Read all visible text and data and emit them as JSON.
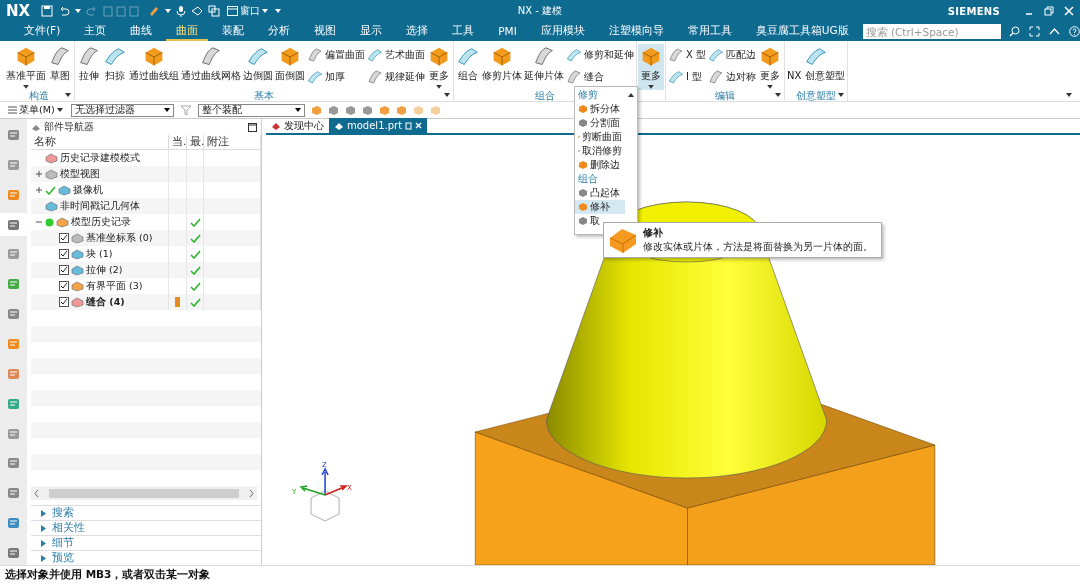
{
  "window": {
    "logo": "NX",
    "title": "NX - 建模",
    "brand": "SIEMENS",
    "window_menu": "窗口"
  },
  "menu_tabs": [
    {
      "label": "文件(F)",
      "selected": false
    },
    {
      "label": "主页",
      "selected": false
    },
    {
      "label": "曲线",
      "selected": false
    },
    {
      "label": "曲面",
      "selected": true
    },
    {
      "label": "装配",
      "selected": false
    },
    {
      "label": "分析",
      "selected": false
    },
    {
      "label": "视图",
      "selected": false
    },
    {
      "label": "显示",
      "selected": false
    },
    {
      "label": "选择",
      "selected": false
    },
    {
      "label": "工具",
      "selected": false
    },
    {
      "label": "PMI",
      "selected": false
    },
    {
      "label": "应用模块",
      "selected": false
    },
    {
      "label": "注塑模向导",
      "selected": false
    },
    {
      "label": "常用工具",
      "selected": false
    },
    {
      "label": "臭豆腐工具箱UG版",
      "selected": false
    }
  ],
  "search": {
    "placeholder": "搜索 (Ctrl+Space)"
  },
  "ribbon_groups": [
    {
      "label": "构造",
      "menu": true,
      "columns": [
        {
          "kind": "large",
          "label": "基准平面",
          "dropdown": true,
          "pressed": false
        },
        {
          "kind": "large",
          "label": "草图",
          "dropdown": false,
          "pressed": false
        }
      ]
    },
    {
      "label": "基本",
      "menu": true,
      "columns": [
        {
          "kind": "large",
          "label": "拉伸",
          "dropdown": false,
          "pressed": false
        },
        {
          "kind": "large",
          "label": "扫掠",
          "dropdown": false,
          "pressed": false
        },
        {
          "kind": "large",
          "label": "通过曲线组",
          "dropdown": false,
          "pressed": false
        },
        {
          "kind": "large",
          "label": "通过曲线网格",
          "dropdown": false,
          "pressed": false
        },
        {
          "kind": "large",
          "label": "边倒圆",
          "dropdown": false,
          "pressed": false
        },
        {
          "kind": "large",
          "label": "面倒圆",
          "dropdown": false,
          "pressed": false
        },
        {
          "kind": "stack",
          "items": [
            "偏置曲面",
            "加厚"
          ]
        },
        {
          "kind": "stack",
          "items": [
            "艺术曲面",
            "规律延伸"
          ]
        },
        {
          "kind": "large",
          "label": "更多",
          "dropdown": true,
          "pressed": false
        }
      ]
    },
    {
      "label": "组合",
      "columns": [
        {
          "kind": "large",
          "label": "组合",
          "dropdown": false,
          "pressed": false
        },
        {
          "kind": "large",
          "label": "修剪片体",
          "dropdown": false,
          "pressed": false
        },
        {
          "kind": "large",
          "label": "延伸片体",
          "dropdown": false,
          "pressed": false
        },
        {
          "kind": "stack",
          "items": [
            "修剪和延伸",
            "缝合"
          ]
        }
      ]
    },
    {
      "columns": [
        {
          "kind": "large",
          "label": "更多",
          "dropdown": true,
          "pressed": true
        }
      ]
    },
    {
      "label": "编辑",
      "menu": true,
      "columns": [
        {
          "kind": "stack",
          "items": [
            "X 型",
            "I 型"
          ]
        },
        {
          "kind": "stack",
          "items": [
            "匹配边",
            "边对称"
          ]
        },
        {
          "kind": "large",
          "label": "更多",
          "dropdown": true,
          "pressed": false
        }
      ]
    },
    {
      "label": "创意塑型",
      "menu": true,
      "columns": [
        {
          "kind": "large",
          "label": "NX 创意塑型",
          "dropdown": false,
          "pressed": false
        }
      ]
    }
  ],
  "toolbar": {
    "menu_button": "菜单(M)",
    "selection_filter": "无选择过滤器",
    "scope": "整个装配"
  },
  "resource_bar": [
    {
      "selected": false
    },
    {
      "selected": false
    },
    {
      "selected": false
    },
    {
      "selected": true
    },
    {
      "selected": false
    },
    {
      "selected": false
    },
    {
      "selected": false
    },
    {
      "selected": false
    },
    {
      "selected": false
    },
    {
      "selected": false
    },
    {
      "selected": false
    },
    {
      "selected": false
    },
    {
      "selected": false
    },
    {
      "selected": false
    },
    {
      "selected": false
    }
  ],
  "navigator": {
    "title": "部件导航器",
    "columns": [
      "名称",
      "当.",
      "最.",
      "附注"
    ],
    "tree": [
      {
        "label": "历史记录建模模式"
      },
      {
        "label": "模型视图",
        "expanded": false
      },
      {
        "label": "摄像机",
        "expanded": false,
        "shown": true
      },
      {
        "label": "非时间戳记几何体"
      },
      {
        "label": "模型历史记录",
        "expanded": true,
        "active": true,
        "latest": true,
        "children": [
          {
            "label": "基准坐标系 (0)",
            "checked": true,
            "latest": true,
            "current": false
          },
          {
            "label": "块 (1)",
            "checked": true,
            "latest": true,
            "current": false
          },
          {
            "label": "拉伸 (2)",
            "checked": true,
            "latest": true,
            "current": false
          },
          {
            "label": "有界平面 (3)",
            "checked": true,
            "latest": true,
            "current": false
          },
          {
            "label": "缝合 (4)",
            "checked": true,
            "latest": true,
            "current": true
          }
        ]
      }
    ],
    "sections": [
      {
        "label": "搜索",
        "expanded": false
      },
      {
        "label": "相关性",
        "expanded": false
      },
      {
        "label": "细节",
        "expanded": false
      },
      {
        "label": "预览",
        "expanded": false
      }
    ]
  },
  "viewport_tabs": [
    {
      "label": "发现中心",
      "selected": false
    },
    {
      "label": "model1.prt",
      "selected": true
    }
  ],
  "dropdown_menu": {
    "sections": [
      {
        "heading": "修剪",
        "items": [
          {
            "label": "拆分体",
            "selected": false
          },
          {
            "label": "分割面",
            "selected": false
          },
          {
            "label": "剪断曲面",
            "selected": false
          },
          {
            "label": "取消修剪",
            "selected": false
          },
          {
            "label": "删除边",
            "selected": false
          }
        ]
      },
      {
        "heading": "组合",
        "items": [
          {
            "label": "凸起体",
            "selected": false
          },
          {
            "label": "修补",
            "selected": true
          },
          {
            "label": "取",
            "selected": false
          }
        ]
      }
    ]
  },
  "tooltip": {
    "title": "修补",
    "description": "修改实体或片体，方法是将面替换为另一片体的面。"
  },
  "triad": {
    "x": "X",
    "y": "Y",
    "z": "Z"
  },
  "status_bar": {
    "text": "选择对象并使用 MB3，或者双击某一对象"
  }
}
